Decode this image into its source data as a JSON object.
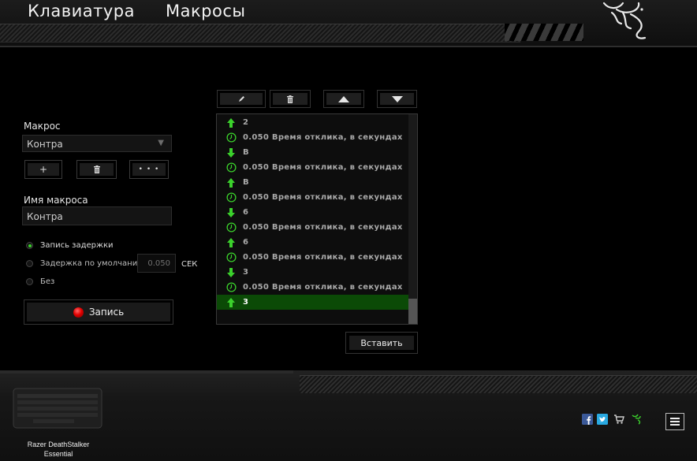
{
  "header": {
    "tabs": [
      {
        "label": "Клавиатура"
      },
      {
        "label": "Макросы"
      }
    ],
    "brand_icon": "razer-snake-logo"
  },
  "macro_panel": {
    "macro_label": "Макрос",
    "macro_selected": "Контра",
    "add_button": "+",
    "delete_icon": "trash-icon",
    "more_button": "• • •",
    "name_label": "Имя макроса",
    "name_value": "Контра",
    "delay_options": [
      {
        "label": "Запись задержки",
        "selected": true
      },
      {
        "label": "Задержка по умолчанию",
        "selected": false
      },
      {
        "label": "Без",
        "selected": false
      }
    ],
    "default_delay_value": "0.050",
    "delay_unit": "СЕК",
    "record_button": "Запись"
  },
  "toolbar": {
    "edit_icon": "pencil-icon",
    "delete_icon": "trash-icon",
    "up_icon": "triangle-up-icon",
    "down_icon": "triangle-down-icon"
  },
  "macro_list": {
    "rows": [
      {
        "kind": "up",
        "text": "2"
      },
      {
        "kind": "delay",
        "text": "0.050 Время отклика, в секундах"
      },
      {
        "kind": "down",
        "text": "В"
      },
      {
        "kind": "delay",
        "text": "0.050 Время отклика, в секундах"
      },
      {
        "kind": "up",
        "text": "В"
      },
      {
        "kind": "delay",
        "text": "0.050 Время отклика, в секундах"
      },
      {
        "kind": "down",
        "text": "6"
      },
      {
        "kind": "delay",
        "text": "0.050 Время отклика, в секундах"
      },
      {
        "kind": "up",
        "text": "6"
      },
      {
        "kind": "delay",
        "text": "0.050 Время отклика, в секундах"
      },
      {
        "kind": "down",
        "text": "3"
      },
      {
        "kind": "delay",
        "text": "0.050 Время отклика, в секундах"
      },
      {
        "kind": "up",
        "text": "3",
        "selected": true
      }
    ],
    "insert_button": "Вставить"
  },
  "footer": {
    "device_name_line1": "Razer DeathStalker",
    "device_name_line2": "Essential",
    "social_icons": [
      "facebook-icon",
      "twitter-icon",
      "cart-icon",
      "razer-icon"
    ],
    "menu_icon": "hamburger-menu-icon"
  },
  "colors": {
    "accent_green": "#3bd12c",
    "selected_row": "#0b4a06",
    "record_red": "#e10000"
  }
}
